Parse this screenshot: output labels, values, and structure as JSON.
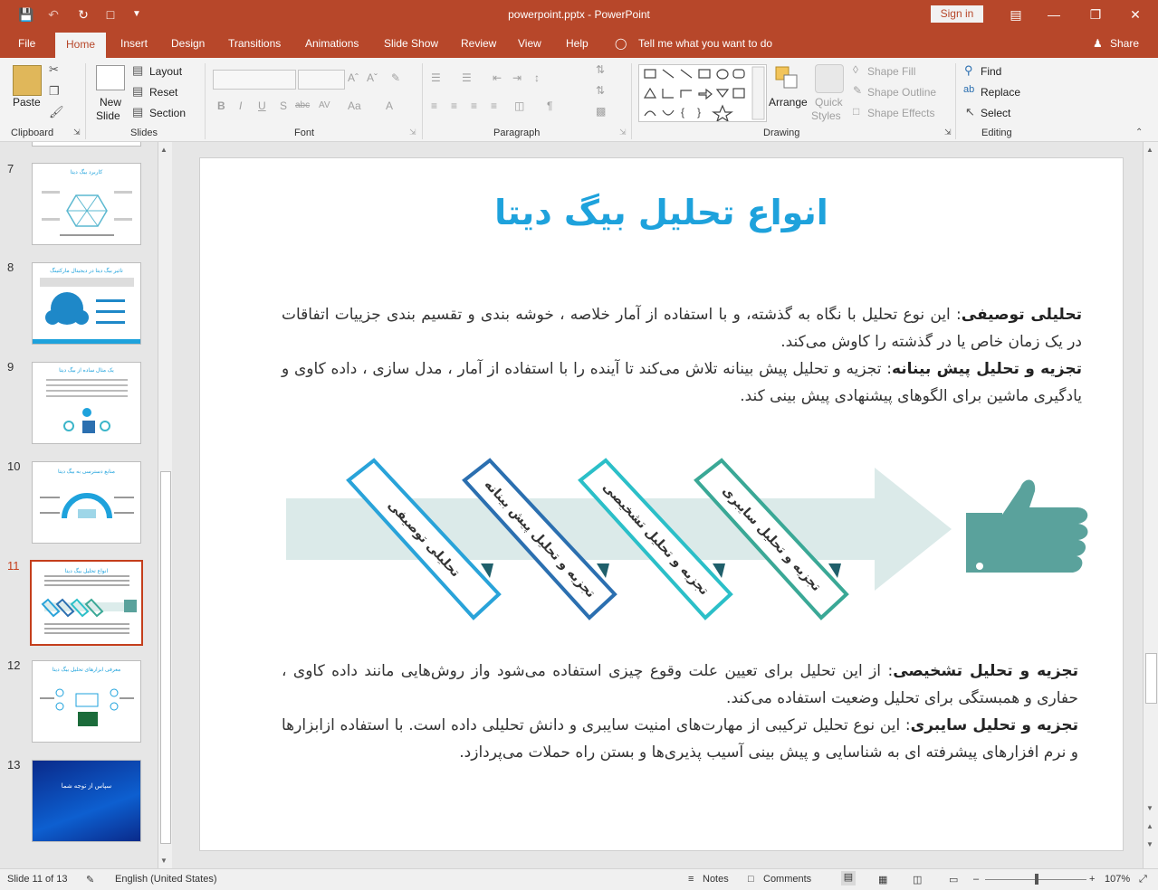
{
  "window": {
    "title": "powerpoint.pptx  -  PowerPoint",
    "signin_label": "Sign in"
  },
  "tabs": [
    "File",
    "Home",
    "Insert",
    "Design",
    "Transitions",
    "Animations",
    "Slide Show",
    "Review",
    "View",
    "Help"
  ],
  "tell_me": "Tell me what you want to do",
  "share_label": "Share",
  "ribbon": {
    "clipboard": {
      "paste": "Paste",
      "group": "Clipboard"
    },
    "slides": {
      "new_slide_1": "New",
      "new_slide_2": "Slide",
      "layout": "Layout",
      "reset": "Reset",
      "section": "Section",
      "group": "Slides"
    },
    "font": {
      "group": "Font",
      "bold": "B",
      "italic": "I",
      "underline": "U",
      "shadow": "S",
      "strike": "abc",
      "spacing": "AV",
      "case": "Aa",
      "color": "A"
    },
    "paragraph": {
      "group": "Paragraph"
    },
    "drawing": {
      "arrange": "Arrange",
      "quick_styles_1": "Quick",
      "quick_styles_2": "Styles",
      "shape_fill": "Shape Fill",
      "shape_outline": "Shape Outline",
      "shape_effects": "Shape Effects",
      "group": "Drawing"
    },
    "editing": {
      "find": "Find",
      "replace": "Replace",
      "select": "Select",
      "group": "Editing"
    }
  },
  "thumbnails": [
    {
      "num": "7",
      "title": "کاربرد بیگ دیتا"
    },
    {
      "num": "8",
      "title": "تاثیر بیگ دیتا در دیجیتال مارکتینگ"
    },
    {
      "num": "9",
      "title": "یک مثال ساده از بیگ دیتا"
    },
    {
      "num": "10",
      "title": "منابع دسترسی به بیگ دیتا"
    },
    {
      "num": "11",
      "title": "انواع تحلیل بیگ دیتا"
    },
    {
      "num": "12",
      "title": "معرفی ابزارهای تحلیل بیگ دیتا"
    },
    {
      "num": "13",
      "title": "سپاس از توجه شما"
    }
  ],
  "slide": {
    "title": "انواع تحلیل بیگ دیتا",
    "para1_bold": "تحلیلی توصیفی",
    "para1_text": ": این نوع تحلیل با نگاه به گذشته، و با استفاده از آمار خلاصه ، خوشه بندی و تقسیم بندی جزییات اتفاقات در یک زمان خاص یا در گذشته را کاوش می‌کند.",
    "para2_bold": "تجزیه و تحلیل پیش بینانه",
    "para2_text": ": تجزیه و تحلیل پیش بینانه تلاش می‌کند تا آینده را با استفاده از آمار ، مدل سازی ، داده کاوی و یادگیری ماشین برای الگوهای پیشنهادی پیش بینی کند.",
    "para3_bold": "تجزیه و تحلیل تشخیصی",
    "para3_text": ": از این تحلیل برای تعیین علت وقوع چیزی استفاده می‌شود واز روش‌هایی مانند داده کاوی ، حفاری و همبستگی برای تحلیل وضعیت استفاده می‌کند.",
    "para4_bold": "تجزیه و تحلیل سایبری",
    "para4_text": ": این نوع تحلیل ترکیبی از مهارت‌های امنیت سایبری و دانش تحلیلی داده است. با استفاده ازابزارها و نرم افزارهای پیشرفته ای به شناسایی و پیش بینی آسیب پذیری‌ها و بستن راه حملات می‌پردازد.",
    "diagram_labels": [
      "تحلیلی توصیفی",
      "تجزیه و تحلیل پیش بینانه",
      "تجزیه و تحلیل تشخیصی",
      "تجزیه و تحلیل سایبری"
    ],
    "diagram_colors": [
      "#29a3d9",
      "#2b6fb0",
      "#2bbfc8",
      "#3aa896"
    ]
  },
  "status": {
    "slide_info": "Slide 11 of 13",
    "language": "English (United States)",
    "notes": "Notes",
    "comments": "Comments",
    "zoom": "107%"
  },
  "colors": {
    "accent": "#b7472a",
    "title_blue": "#1ea2dc"
  }
}
